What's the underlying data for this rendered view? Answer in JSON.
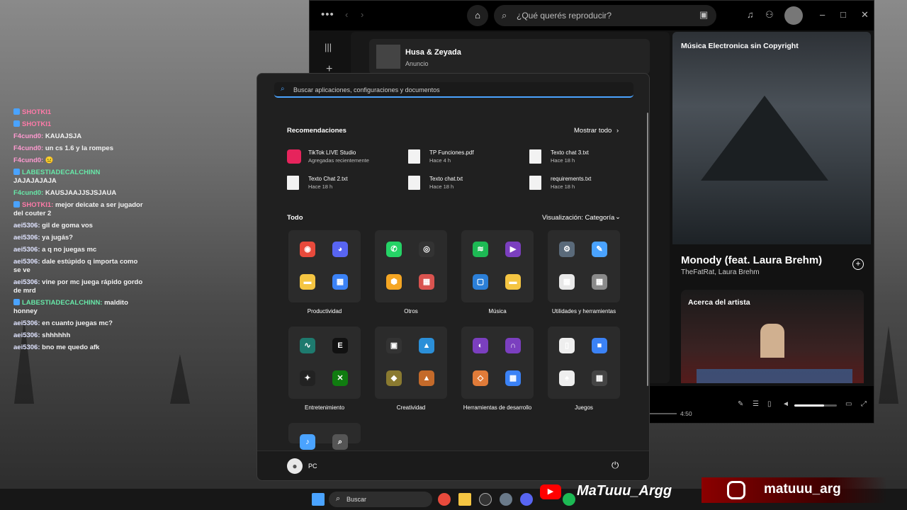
{
  "chat": [
    {
      "user": "SHOTKI1",
      "text": "",
      "cls": "u1",
      "badge": true
    },
    {
      "user": "SHOTKI1",
      "text": "",
      "cls": "u1",
      "badge": true
    },
    {
      "user": "F4cund0:",
      "text": "KAUAJSJA",
      "cls": "u3"
    },
    {
      "user": "F4cund0:",
      "text": "un cs 1.6 y la rompes",
      "cls": "u3"
    },
    {
      "user": "F4cund0:",
      "text": "",
      "cls": "u3",
      "emote": true
    },
    {
      "user": "LABESTIADECALCHINN",
      "text": "JAJAJAJAJA",
      "cls": "u2",
      "badge": true,
      "newline": true
    },
    {
      "user": "F4cund0:",
      "text": "KAUSJAAJJSJSJAUA",
      "cls": "u2"
    },
    {
      "user": "SHOTKI1:",
      "text": "mejor deicate a ser jugador del couter 2",
      "cls": "u1",
      "badge": true
    },
    {
      "user": "aei5306:",
      "text": "gil de goma vos",
      "cls": "u4"
    },
    {
      "user": "aei5306:",
      "text": "ya jugás?",
      "cls": "u4"
    },
    {
      "user": "aei5306:",
      "text": "a q no juegas mc",
      "cls": "u4"
    },
    {
      "user": "aei5306:",
      "text": "dale estúpido q importa como se ve",
      "cls": "u4"
    },
    {
      "user": "aei5306:",
      "text": "vine por mc juega rápido gordo de mrd",
      "cls": "u4"
    },
    {
      "user": "LABESTIADECALCHINN:",
      "text": "maldito honney",
      "cls": "u2",
      "badge": true
    },
    {
      "user": "aei5306:",
      "text": "en cuanto juegas mc?",
      "cls": "u4"
    },
    {
      "user": "aei5306:",
      "text": "shhhhhh",
      "cls": "u4"
    },
    {
      "user": "aei5306:",
      "text": "bno me quedo afk",
      "cls": "u4"
    }
  ],
  "spotify": {
    "search_placeholder": "¿Qué querés reproducir?",
    "ad_title": "Husa & Zeyada",
    "ad_sub": "Anuncio",
    "playlist": "Música Electronica sin Copyright",
    "track": "Monody (feat. Laura Brehm)",
    "artists": "TheFatRat, Laura Brehm",
    "about": "Acerca del artista",
    "duration": "4:50",
    "volume": 0.7
  },
  "start": {
    "search_placeholder": "Buscar aplicaciones, configuraciones y documentos",
    "rec_title": "Recomendaciones",
    "show_all": "Mostrar todo",
    "recs": [
      {
        "name": "TikTok LIVE Studio",
        "time": "Agregadas recientemente",
        "icon": "tiktok-icon"
      },
      {
        "name": "TP Funciones.pdf",
        "time": "Hace 4 h",
        "icon": "document-icon"
      },
      {
        "name": "Texto chat 3.txt",
        "time": "Hace 18 h",
        "icon": "document-icon"
      },
      {
        "name": "Texto Chat 2.txt",
        "time": "Hace 18 h",
        "icon": "document-icon"
      },
      {
        "name": "Texto chat.txt",
        "time": "Hace 18 h",
        "icon": "document-icon"
      },
      {
        "name": "requirements.txt",
        "time": "Hace 18 h",
        "icon": "document-icon"
      }
    ],
    "all_title": "Todo",
    "view_label": "Visualización: Categoría",
    "groups": [
      {
        "label": "Productividad",
        "icons": [
          {
            "n": "chrome-icon",
            "c": "#e84a3c",
            "g": "◉"
          },
          {
            "n": "discord-icon",
            "c": "#5865f2",
            "g": "◕"
          },
          {
            "n": "folder-icon",
            "c": "#f5c542",
            "g": "▬"
          },
          {
            "n": "app-icon",
            "c": "#3b82f6",
            "g": "▦"
          }
        ]
      },
      {
        "label": "Otros",
        "icons": [
          {
            "n": "whatsapp-icon",
            "c": "#25d366",
            "g": "✆"
          },
          {
            "n": "obs-icon",
            "c": "#333",
            "g": "◎"
          },
          {
            "n": "hexagon-icon",
            "c": "#f5a623",
            "g": "⬢"
          },
          {
            "n": "apps-icon",
            "c": "#d9534f",
            "g": "▦"
          }
        ]
      },
      {
        "label": "Música",
        "icons": [
          {
            "n": "spotify-icon",
            "c": "#1db954",
            "g": "≋"
          },
          {
            "n": "media-player-icon",
            "c": "#7b3fbf",
            "g": "▶"
          },
          {
            "n": "window-icon",
            "c": "#2b7fd8",
            "g": "▢"
          },
          {
            "n": "folder-icon",
            "c": "#f5c542",
            "g": "▬"
          }
        ]
      },
      {
        "label": "Utilidades y herramientas",
        "icons": [
          {
            "n": "settings-icon",
            "c": "#5a6a7a",
            "g": "⚙"
          },
          {
            "n": "paint-icon",
            "c": "#4aa3ff",
            "g": "✎"
          },
          {
            "n": "store-icon",
            "c": "#e8e8e8",
            "g": "▦"
          },
          {
            "n": "tools-icon",
            "c": "#8a8a8a",
            "g": "▦"
          }
        ]
      },
      {
        "label": "Entretenimiento",
        "icons": [
          {
            "n": "wave-icon",
            "c": "#1e7a6e",
            "g": "∿"
          },
          {
            "n": "epic-games-icon",
            "c": "#111",
            "g": "E"
          },
          {
            "n": "bird-icon",
            "c": "#222",
            "g": "✦"
          },
          {
            "n": "xbox-icon",
            "c": "#107c10",
            "g": "✕"
          }
        ]
      },
      {
        "label": "Creatividad",
        "icons": [
          {
            "n": "camera-icon",
            "c": "#333",
            "g": "▣"
          },
          {
            "n": "photos-icon",
            "c": "#2b8fd8",
            "g": "▲"
          },
          {
            "n": "clipchamp-icon",
            "c": "#8a7a30",
            "g": "◆"
          },
          {
            "n": "paint3d-icon",
            "c": "#c46a2a",
            "g": "▲"
          }
        ]
      },
      {
        "label": "Herramientas de desarrollo",
        "icons": [
          {
            "n": "github-icon",
            "c": "#7b3fbf",
            "g": "◐"
          },
          {
            "n": "arc-icon",
            "c": "#7b3fbf",
            "g": "∩"
          },
          {
            "n": "vscode-icon",
            "c": "#e07b39",
            "g": "◇"
          },
          {
            "n": "devtools-icon",
            "c": "#3b82f6",
            "g": "▦"
          }
        ]
      },
      {
        "label": "Juegos",
        "icons": [
          {
            "n": "document-icon",
            "c": "#eee",
            "g": "▯"
          },
          {
            "n": "roblox-icon",
            "c": "#3b82f6",
            "g": "■"
          },
          {
            "n": "solitaire-icon",
            "c": "#eee",
            "g": "♠"
          },
          {
            "n": "gaming-icon",
            "c": "#444",
            "g": "▦"
          }
        ]
      },
      {
        "label": "",
        "icons": [
          {
            "n": "voice-access-icon",
            "c": "#4aa3ff",
            "g": "♪"
          },
          {
            "n": "magnifier-icon",
            "c": "#555",
            "g": "⌕"
          }
        ]
      }
    ],
    "user": "PC"
  },
  "taskbar": {
    "search": "Buscar"
  },
  "overlay": {
    "youtube": "MaTuuu_Argg",
    "instagram": "matuuu_arg"
  }
}
